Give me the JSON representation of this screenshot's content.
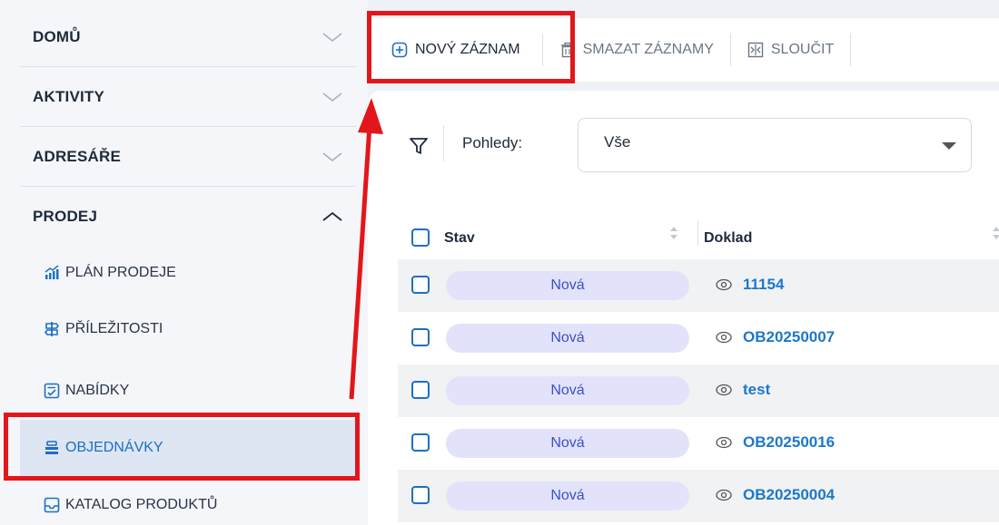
{
  "sidebar": {
    "sections": [
      {
        "label": "DOMŮ",
        "expanded": false
      },
      {
        "label": "AKTIVITY",
        "expanded": false
      },
      {
        "label": "ADRESÁŘE",
        "expanded": false
      },
      {
        "label": "PRODEJ",
        "expanded": true
      }
    ],
    "items": [
      {
        "label": "PLÁN PRODEJE",
        "icon": "chart-growth-icon"
      },
      {
        "label": "PŘÍLEŽITOSTI",
        "icon": "signpost-icon"
      },
      {
        "label": "NABÍDKY",
        "icon": "quote-document-icon"
      },
      {
        "label": "OBJEDNÁVKY",
        "icon": "orders-stack-icon",
        "active": true
      },
      {
        "label": "KATALOG PRODUKTŮ",
        "icon": "catalog-inbox-icon"
      }
    ]
  },
  "toolbar": {
    "new_label": "NOVÝ ZÁZNAM",
    "delete_label": "SMAZAT ZÁZNAMY",
    "merge_label": "SLOUČIT"
  },
  "views": {
    "label": "Pohledy:",
    "selected": "Vše"
  },
  "table": {
    "columns": [
      "Stav",
      "Doklad"
    ],
    "rows": [
      {
        "status": "Nová",
        "doc": "11154"
      },
      {
        "status": "Nová",
        "doc": "OB20250007"
      },
      {
        "status": "Nová",
        "doc": "test"
      },
      {
        "status": "Nová",
        "doc": "OB20250016"
      },
      {
        "status": "Nová",
        "doc": "OB20250004"
      }
    ]
  },
  "colors": {
    "accent": "#1d6fc4",
    "annotation": "#e3161b",
    "status_pill": "#e2e3fb"
  }
}
